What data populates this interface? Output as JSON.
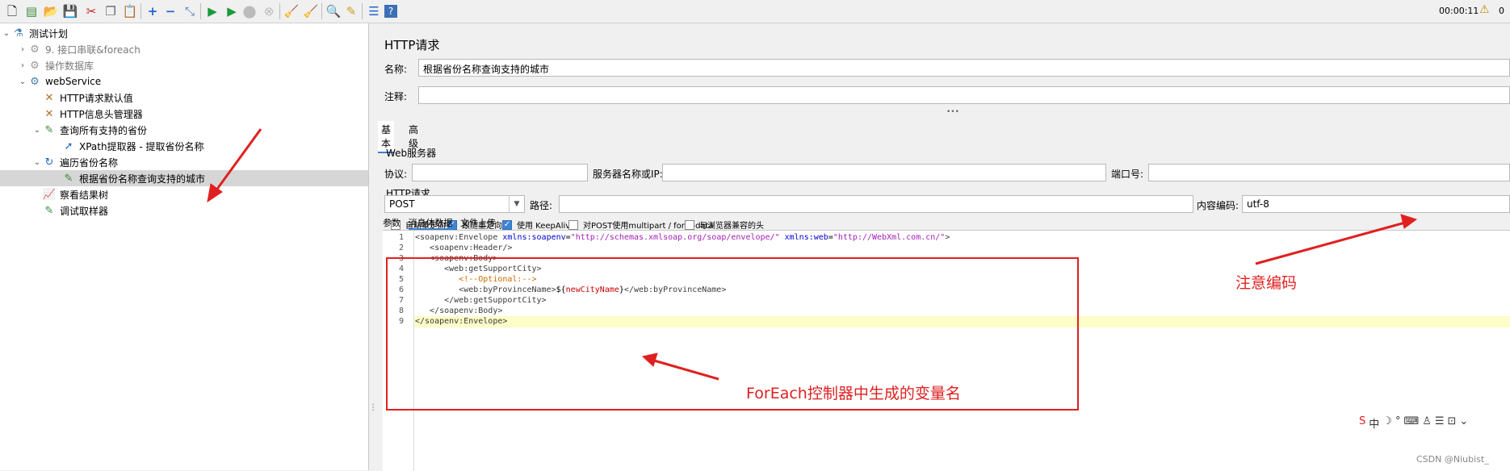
{
  "toolbar": {
    "timer": "00:00:11",
    "warning_count": "0",
    "icons": [
      "new-icon",
      "templates-icon",
      "open-icon",
      "save-icon",
      "cut-icon",
      "copy-icon",
      "paste-icon",
      "expand-icon",
      "collapse-icon",
      "toggle-icon",
      "start-icon",
      "start-no-pause-icon",
      "stop-icon",
      "shutdown-icon",
      "clear-icon",
      "clear-all-icon",
      "search-icon",
      "reset-search-icon",
      "function-helper-icon",
      "help-icon"
    ]
  },
  "tree": {
    "items": [
      {
        "label": "测试计划"
      },
      {
        "label": "9. 接口串联&foreach"
      },
      {
        "label": "操作数据库"
      },
      {
        "label": "webService"
      },
      {
        "label": "HTTP请求默认值"
      },
      {
        "label": "HTTP信息头管理器"
      },
      {
        "label": "查询所有支持的省份"
      },
      {
        "label": "XPath提取器 - 提取省份名称"
      },
      {
        "label": "遍历省份名称"
      },
      {
        "label": "根据省份名称查询支持的城市"
      },
      {
        "label": "察看结果树"
      },
      {
        "label": "调试取样器"
      }
    ]
  },
  "panel": {
    "title": "HTTP请求",
    "name_label": "名称:",
    "name_value": "根据省份名称查询支持的城市",
    "comment_label": "注释:",
    "comment_value": "",
    "tabs": [
      "基本",
      "高级"
    ],
    "web_server_title": "Web服务器",
    "protocol_label": "协议:",
    "server_label": "服务器名称或IP:",
    "port_label": "端口号:",
    "http_request_title": "HTTP请求",
    "method": "POST",
    "path_label": "路径:",
    "encoding_label": "内容编码:",
    "encoding_value": "utf-8",
    "checkboxes": [
      {
        "label": "自动重定向",
        "checked": false
      },
      {
        "label": "跟随重定向",
        "checked": true
      },
      {
        "label": "使用 KeepAlive",
        "checked": true
      },
      {
        "label": "对POST使用multipart / form-data",
        "checked": false
      },
      {
        "label": "与浏览器兼容的头",
        "checked": false
      }
    ],
    "body_tabs": [
      "参数",
      "消息体数据",
      "文件上传"
    ]
  },
  "code": {
    "line_numbers": [
      "1",
      "2",
      "3",
      "4",
      "5",
      "6",
      "7",
      "8",
      "9"
    ]
  },
  "annotations": {
    "encoding_note": "注意编码",
    "variable_note": "ForEach控制器中生成的变量名"
  },
  "watermark": "CSDN @Niubist_"
}
